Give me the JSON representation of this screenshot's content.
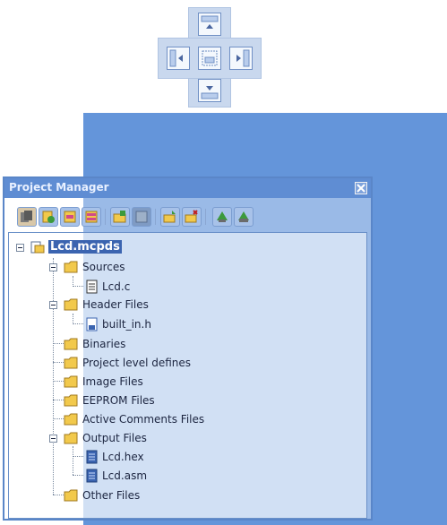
{
  "panel": {
    "title": "Project Manager",
    "close_icon": "close-icon"
  },
  "toolbar": {
    "buttons": [
      {
        "name": "open-project-icon"
      },
      {
        "name": "add-file-icon"
      },
      {
        "name": "remove-file-icon"
      },
      {
        "name": "project-settings-icon"
      },
      {
        "name": "new-folder-icon"
      },
      {
        "name": "save-icon"
      },
      {
        "name": "add-to-project-icon"
      },
      {
        "name": "remove-from-project-icon"
      },
      {
        "name": "build-icon"
      },
      {
        "name": "build-all-icon"
      }
    ]
  },
  "tree": {
    "root": "Lcd.mcpds",
    "sources": "Sources",
    "source_file": "Lcd.c",
    "header_files": "Header Files",
    "header_file": "built_in.h",
    "binaries": "Binaries",
    "project_defines": "Project level defines",
    "image_files": "Image Files",
    "eeprom_files": "EEPROM Files",
    "active_comments": "Active Comments Files",
    "output_files": "Output Files",
    "output_hex": "Lcd.hex",
    "output_asm": "Lcd.asm",
    "other_files": "Other Files"
  },
  "colors": {
    "dock_preview": "#2e70cd",
    "selection": "#3b64b0",
    "folder": "#f2c94c"
  }
}
